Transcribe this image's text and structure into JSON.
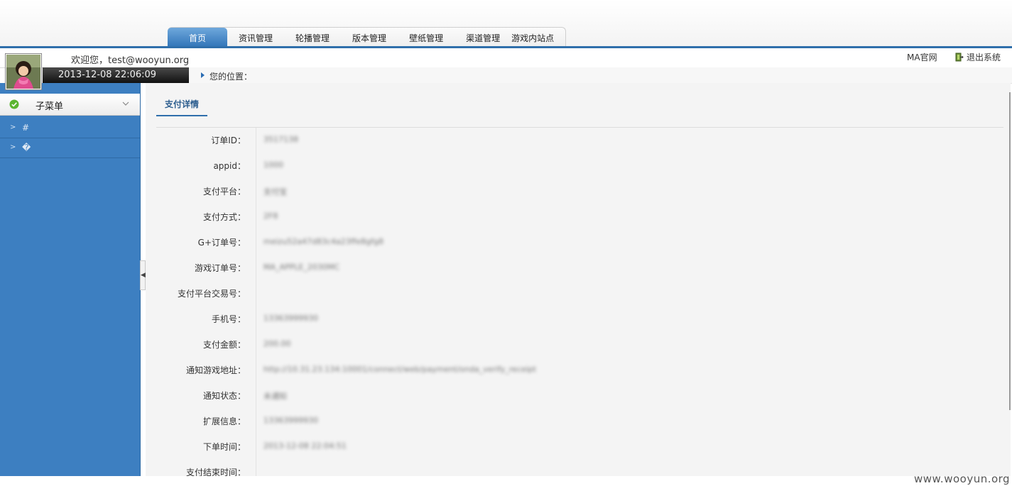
{
  "nav": {
    "tabs": [
      "首页",
      "资讯管理",
      "轮播管理",
      "版本管理",
      "壁纸管理",
      "渠道管理",
      "游戏内站点"
    ]
  },
  "header": {
    "welcome": "欢迎您，test@wooyun.org",
    "datetime": "2013-12-08 22:06:09",
    "location_label": "您的位置：",
    "ma_link": "MA官网",
    "logout_link": "退出系统"
  },
  "sidebar": {
    "submenu_label": "子菜单",
    "items": [
      "#",
      "�"
    ]
  },
  "main": {
    "tab_label": "支付详情",
    "rows": [
      {
        "label": "订单ID：",
        "value": "3517138"
      },
      {
        "label": "appid：",
        "value": "1000"
      },
      {
        "label": "支付平台：",
        "value": "支付宝"
      },
      {
        "label": "支付方式：",
        "value": "2F8"
      },
      {
        "label": "G+订单号：",
        "value": "meizu52a47d83c4a23ffe8gfg8"
      },
      {
        "label": "游戏订单号：",
        "value": "MA_APPLE_2030MC"
      },
      {
        "label": "支付平台交易号：",
        "value": ""
      },
      {
        "label": "手机号：",
        "value": "13363999930"
      },
      {
        "label": "支付金额：",
        "value": "200.00"
      },
      {
        "label": "通知游戏地址：",
        "value": "http://10.31.23.134:10001/connect/web/payment/onda_verify_receipt"
      },
      {
        "label": "通知状态：",
        "value": "未通知"
      },
      {
        "label": "扩展信息：",
        "value": "13363999930"
      },
      {
        "label": "下单时间：",
        "value": "2013-12-08 22:04:51"
      },
      {
        "label": "支付结束时间：",
        "value": ""
      }
    ]
  },
  "watermark": "www.wooyun.org",
  "colors": {
    "brand_blue": "#2f6fab",
    "sidebar_blue": "#3d7fc1"
  }
}
